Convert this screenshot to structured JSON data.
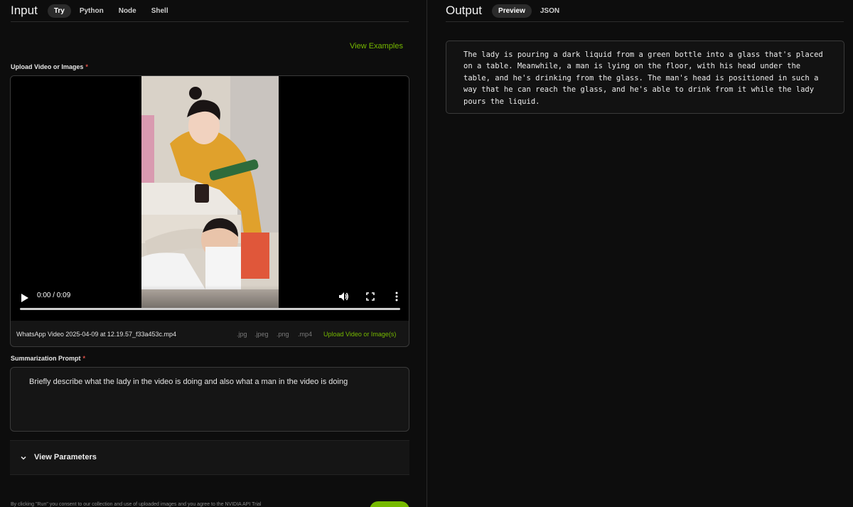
{
  "input_panel": {
    "title": "Input",
    "tabs": [
      {
        "label": "Try",
        "active": true
      },
      {
        "label": "Python",
        "active": false
      },
      {
        "label": "Node",
        "active": false
      },
      {
        "label": "Shell",
        "active": false
      }
    ],
    "view_examples_label": "View Examples",
    "upload": {
      "label": "Upload Video or Images",
      "required_marker": "*",
      "video_time": "0:00 / 0:09",
      "file_name": "WhatsApp Video 2025-04-09 at 12.19.57_f33a453c.mp4",
      "extensions": [
        ".jpg",
        ".jpeg",
        ".png",
        ".mp4"
      ],
      "upload_link_label": "Upload Video or Image(s)"
    },
    "prompt": {
      "label": "Summarization Prompt",
      "required_marker": "*",
      "value": "Briefly describe what the lady in the video is doing and also what a man in the video is doing"
    },
    "parameters_label": "View Parameters",
    "consent_text": "By clicking \"Run\" you consent to our collection and use of uploaded images and you agree to the NVIDIA API Trial"
  },
  "output_panel": {
    "title": "Output",
    "tabs": [
      {
        "label": "Preview",
        "active": true
      },
      {
        "label": "JSON",
        "active": false
      }
    ],
    "text": "The lady is pouring a dark liquid from a green bottle into a glass that's placed on a table. Meanwhile, a man is lying on the floor, with his head under the table, and he's drinking from the glass. The man's head is positioned in such a way that he can reach the glass, and he's able to drink from it while the lady pours the liquid."
  },
  "colors": {
    "accent": "#76b900",
    "required": "#e0524a",
    "background": "#0d0d0d",
    "panel": "#151515",
    "border": "#3a3a3a"
  },
  "icons": {
    "play": "play-icon",
    "volume": "volume-icon",
    "fullscreen": "fullscreen-icon",
    "more": "more-vertical-icon",
    "chevron": "chevron-down-icon"
  }
}
